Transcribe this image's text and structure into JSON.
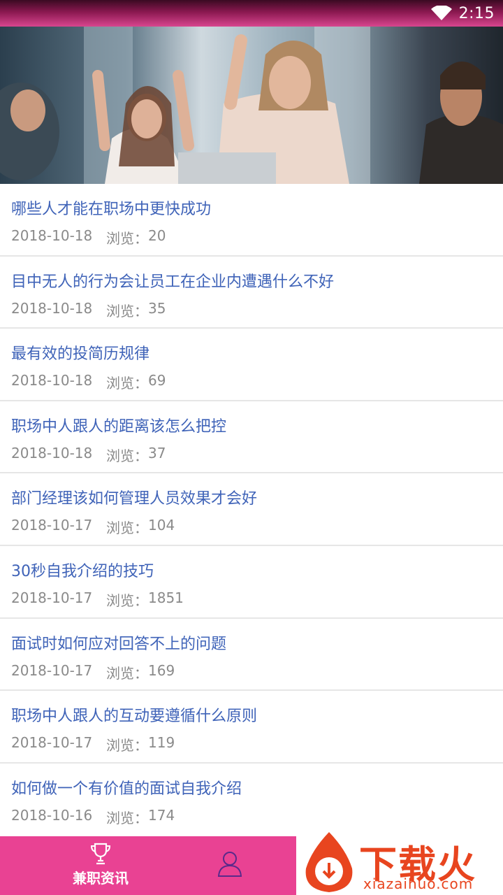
{
  "status_bar": {
    "time": "2:15"
  },
  "banner": {
    "slides": 3,
    "active_slide": 1
  },
  "news": [
    {
      "title": "哪些人才能在职场中更快成功",
      "date": "2018-10-18",
      "views_label": "浏览：",
      "views": "20"
    },
    {
      "title": "目中无人的行为会让员工在企业内遭遇什么不好",
      "date": "2018-10-18",
      "views_label": "浏览：",
      "views": "35"
    },
    {
      "title": "最有效的投简历规律",
      "date": "2018-10-18",
      "views_label": "浏览：",
      "views": "69"
    },
    {
      "title": "职场中人跟人的距离该怎么把控",
      "date": "2018-10-18",
      "views_label": "浏览：",
      "views": "37"
    },
    {
      "title": "部门经理该如何管理人员效果才会好",
      "date": "2018-10-17",
      "views_label": "浏览：",
      "views": "104"
    },
    {
      "title": "30秒自我介绍的技巧",
      "date": "2018-10-17",
      "views_label": "浏览：",
      "views": "1851"
    },
    {
      "title": "面试时如何应对回答不上的问题",
      "date": "2018-10-17",
      "views_label": "浏览：",
      "views": "169"
    },
    {
      "title": "职场中人跟人的互动要遵循什么原则",
      "date": "2018-10-17",
      "views_label": "浏览：",
      "views": "119"
    },
    {
      "title": "如何做一个有价值的面试自我介绍",
      "date": "2018-10-16",
      "views_label": "浏览：",
      "views": "174"
    }
  ],
  "tab_bar": {
    "tabs": [
      {
        "label": "兼职资讯",
        "icon": "trophy-icon"
      },
      {
        "label": "",
        "icon": "user-icon"
      }
    ]
  },
  "watermark": {
    "title": "下载火",
    "site": "xiazaihuo.com"
  },
  "colors": {
    "accent": "#e94293",
    "title_blue": "#3f63b8",
    "meta_gray": "#8a8a8a"
  }
}
